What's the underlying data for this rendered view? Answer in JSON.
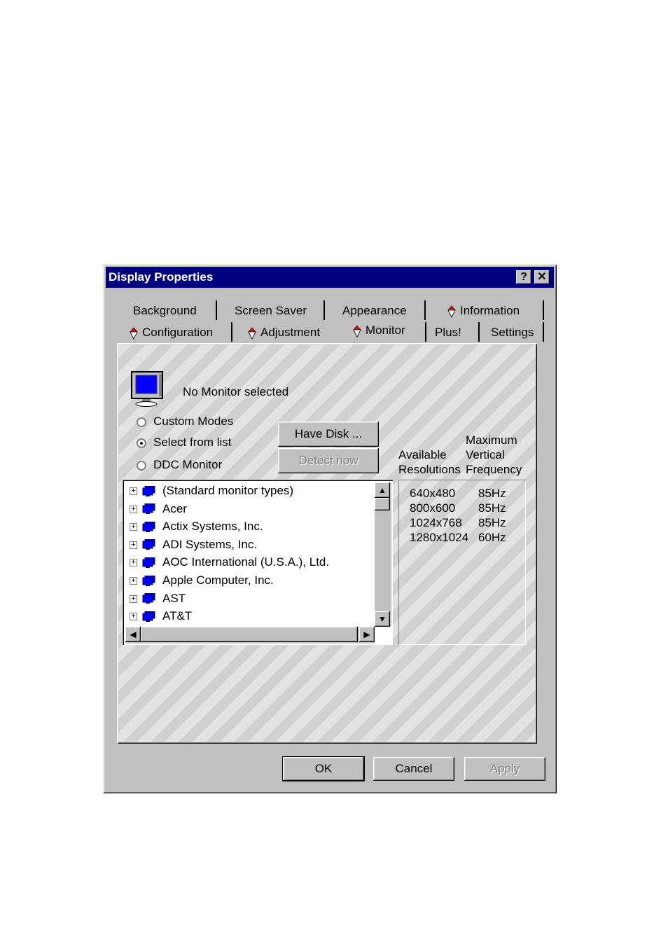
{
  "window": {
    "title": "Display Properties",
    "help_label": "?",
    "close_label": "✕"
  },
  "tabs_row1": [
    {
      "label": "Background"
    },
    {
      "label": "Screen Saver"
    },
    {
      "label": "Appearance"
    },
    {
      "label": "Information",
      "icon": "diamond-icon"
    }
  ],
  "tabs_row2": [
    {
      "label": "Configuration",
      "icon": "diamond-icon"
    },
    {
      "label": "Adjustment",
      "icon": "diamond-icon"
    },
    {
      "label": "Monitor",
      "icon": "diamond-icon",
      "selected": true
    },
    {
      "label": "Plus!"
    },
    {
      "label": "Settings"
    }
  ],
  "monitor": {
    "status": "No Monitor selected",
    "radios": [
      {
        "label": "Custom Modes",
        "selected": false
      },
      {
        "label": "Select from list",
        "selected": true
      },
      {
        "label": "DDC Monitor",
        "selected": false
      }
    ],
    "have_disk_label": "Have Disk ...",
    "detect_now_label": "Detect now",
    "list_items": [
      "(Standard monitor types)",
      "Acer",
      "Actix Systems, Inc.",
      "ADI Systems, Inc.",
      "AOC International (U.S.A.), Ltd.",
      "Apple Computer, Inc.",
      "AST",
      "AT&T"
    ],
    "res_header_left_1": "Available",
    "res_header_left_2": "Resolutions",
    "res_header_right_1": "Maximum",
    "res_header_right_2": "Vertical",
    "res_header_right_3": "Frequency",
    "resolutions": [
      {
        "res": "640x480",
        "freq": "85Hz"
      },
      {
        "res": "800x600",
        "freq": "85Hz"
      },
      {
        "res": "1024x768",
        "freq": "85Hz"
      },
      {
        "res": "1280x1024",
        "freq": "60Hz"
      }
    ]
  },
  "buttons": {
    "ok": "OK",
    "cancel": "Cancel",
    "apply": "Apply"
  },
  "colors": {
    "titlebar": "#000080",
    "face": "#c0c0c0",
    "monitor_screen": "#0000ff"
  }
}
